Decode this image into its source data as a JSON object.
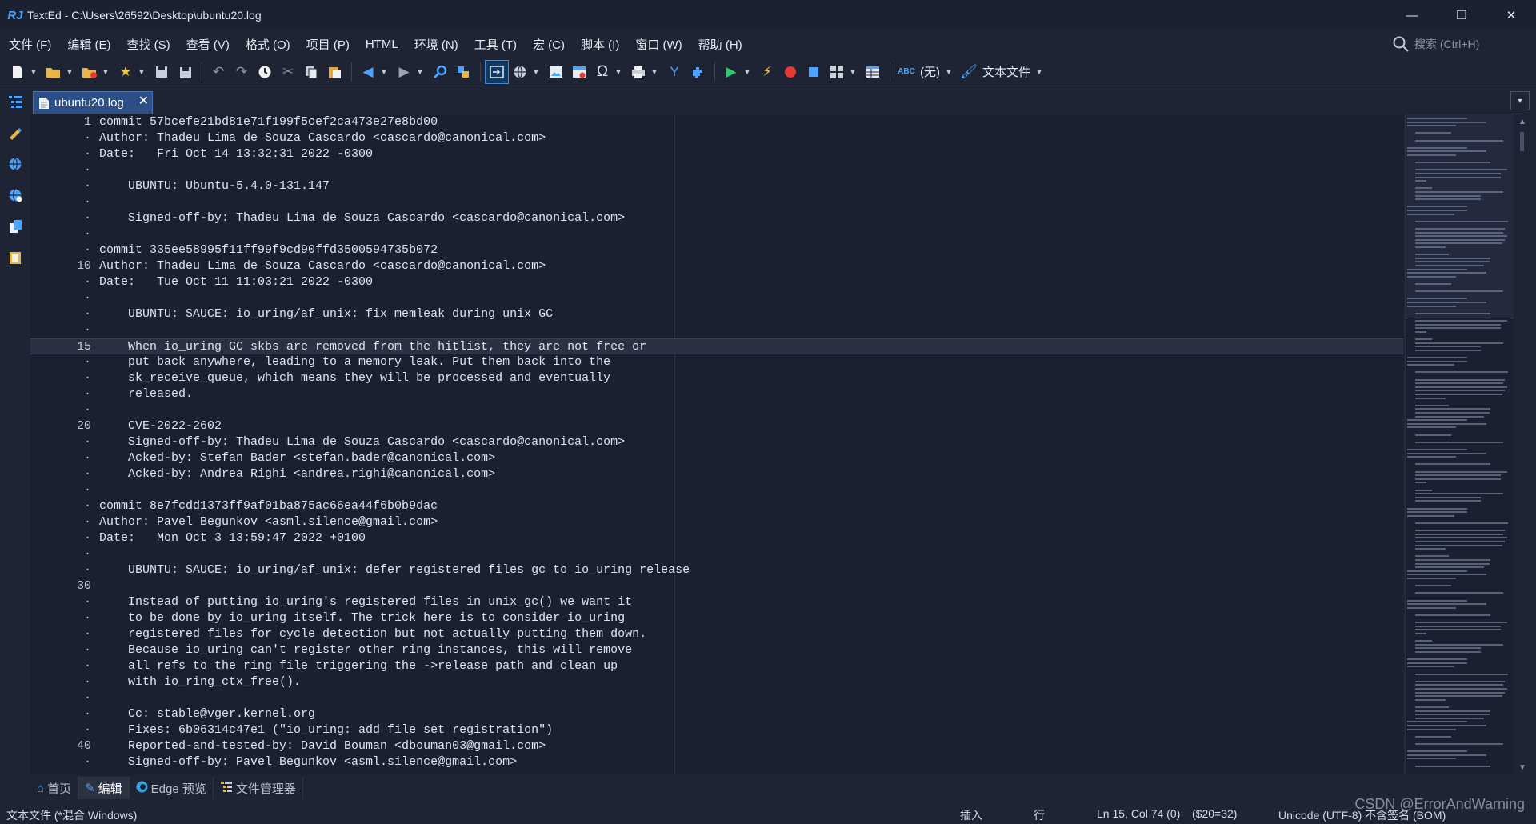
{
  "window": {
    "title": "TextEd - C:\\Users\\26592\\Desktop\\ubuntu20.log",
    "logo": "RJ",
    "minimize": "—",
    "restore": "❐",
    "close": "✕"
  },
  "menu": {
    "items": [
      "文件 (F)",
      "编辑 (E)",
      "查找 (S)",
      "查看 (V)",
      "格式 (O)",
      "项目 (P)",
      "HTML",
      "环境 (N)",
      "工具 (T)",
      "宏 (C)",
      "脚本 (I)",
      "窗口 (W)",
      "帮助 (H)"
    ],
    "search_placeholder": "搜索 (Ctrl+H)"
  },
  "toolbar": {
    "spellcheck_value": "(无)",
    "filetype_label": "文本文件",
    "icons": [
      "new-file-icon",
      "open-folder-icon",
      "recent-folder-icon",
      "favorites-star-icon",
      "save-icon",
      "save-all-icon",
      "undo-icon",
      "redo-icon",
      "history-clock-icon",
      "cut-icon",
      "copy-icon",
      "paste-icon",
      "back-arrow-icon",
      "forward-arrow-icon",
      "find-icon",
      "replace-icon",
      "insert-icon",
      "globe-icon",
      "image-icon",
      "table-icon",
      "omega-icon",
      "print-icon",
      "tools-icon",
      "plugin-icon",
      "play-icon",
      "flash-icon",
      "record-icon",
      "stop-icon",
      "layout-icon",
      "grid-icon",
      "abc-icon",
      "brush-icon"
    ]
  },
  "tab": {
    "label": "ubuntu20.log",
    "close": "✕",
    "menu": "▾"
  },
  "editor": {
    "current_line": 15,
    "lines": [
      {
        "n": "1",
        "text": "commit 57bcefe21bd81e71f199f5cef2ca473e27e8bd00"
      },
      {
        "n": "·",
        "text": "Author: Thadeu Lima de Souza Cascardo <cascardo@canonical.com>"
      },
      {
        "n": "·",
        "text": "Date:   Fri Oct 14 13:32:31 2022 -0300"
      },
      {
        "n": "·",
        "text": ""
      },
      {
        "n": "·",
        "text": "    UBUNTU: Ubuntu-5.4.0-131.147"
      },
      {
        "n": "·",
        "text": ""
      },
      {
        "n": "·",
        "text": "    Signed-off-by: Thadeu Lima de Souza Cascardo <cascardo@canonical.com>"
      },
      {
        "n": "·",
        "text": ""
      },
      {
        "n": "·",
        "text": "commit 335ee58995f11ff99f9cd90ffd3500594735b072"
      },
      {
        "n": "10",
        "text": "Author: Thadeu Lima de Souza Cascardo <cascardo@canonical.com>"
      },
      {
        "n": "·",
        "text": "Date:   Tue Oct 11 11:03:21 2022 -0300"
      },
      {
        "n": "·",
        "text": ""
      },
      {
        "n": "·",
        "text": "    UBUNTU: SAUCE: io_uring/af_unix: fix memleak during unix GC"
      },
      {
        "n": "·",
        "text": ""
      },
      {
        "n": "15",
        "text": "    When io_uring GC skbs are removed from the hitlist, they are not free or"
      },
      {
        "n": "·",
        "text": "    put back anywhere, leading to a memory leak. Put them back into the"
      },
      {
        "n": "·",
        "text": "    sk_receive_queue, which means they will be processed and eventually"
      },
      {
        "n": "·",
        "text": "    released."
      },
      {
        "n": "·",
        "text": ""
      },
      {
        "n": "20",
        "text": "    CVE-2022-2602"
      },
      {
        "n": "·",
        "text": "    Signed-off-by: Thadeu Lima de Souza Cascardo <cascardo@canonical.com>"
      },
      {
        "n": "·",
        "text": "    Acked-by: Stefan Bader <stefan.bader@canonical.com>"
      },
      {
        "n": "·",
        "text": "    Acked-by: Andrea Righi <andrea.righi@canonical.com>"
      },
      {
        "n": "·",
        "text": ""
      },
      {
        "n": "·",
        "text": "commit 8e7fcdd1373ff9af01ba875ac66ea44f6b0b9dac"
      },
      {
        "n": "·",
        "text": "Author: Pavel Begunkov <asml.silence@gmail.com>"
      },
      {
        "n": "·",
        "text": "Date:   Mon Oct 3 13:59:47 2022 +0100"
      },
      {
        "n": "·",
        "text": ""
      },
      {
        "n": "·",
        "text": "    UBUNTU: SAUCE: io_uring/af_unix: defer registered files gc to io_uring release"
      },
      {
        "n": "30",
        "text": ""
      },
      {
        "n": "·",
        "text": "    Instead of putting io_uring's registered files in unix_gc() we want it"
      },
      {
        "n": "·",
        "text": "    to be done by io_uring itself. The trick here is to consider io_uring"
      },
      {
        "n": "·",
        "text": "    registered files for cycle detection but not actually putting them down."
      },
      {
        "n": "·",
        "text": "    Because io_uring can't register other ring instances, this will remove"
      },
      {
        "n": "·",
        "text": "    all refs to the ring file triggering the ->release path and clean up"
      },
      {
        "n": "·",
        "text": "    with io_ring_ctx_free()."
      },
      {
        "n": "·",
        "text": ""
      },
      {
        "n": "·",
        "text": "    Cc: stable@vger.kernel.org"
      },
      {
        "n": "·",
        "text": "    Fixes: 6b06314c47e1 (\"io_uring: add file set registration\")"
      },
      {
        "n": "40",
        "text": "    Reported-and-tested-by: David Bouman <dbouman03@gmail.com>"
      },
      {
        "n": "·",
        "text": "    Signed-off-by: Pavel Begunkov <asml.silence@gmail.com>"
      }
    ]
  },
  "view_tabs": [
    {
      "label": "首页",
      "icon": "home-icon"
    },
    {
      "label": "编辑",
      "icon": "edit-pencil-icon"
    },
    {
      "label": "Edge 预览",
      "icon": "edge-browser-icon"
    },
    {
      "label": "文件管理器",
      "icon": "file-manager-icon"
    }
  ],
  "status": {
    "file_type": "文本文件 (*混合 Windows)",
    "mode": "插入",
    "row_label": "行",
    "position": "Ln 15, Col 74 (0)",
    "code": "($20=32)",
    "encoding": "Unicode (UTF-8) 不含签名 (BOM)"
  },
  "watermark": "CSDN @ErrorAndWarning",
  "colors": {
    "background": "#1b2030",
    "chrome": "#1e2433",
    "active_tab": "#2d4f87",
    "accent_blue": "#4da3ff",
    "play_green": "#2ecc71",
    "record_red": "#e53935"
  }
}
